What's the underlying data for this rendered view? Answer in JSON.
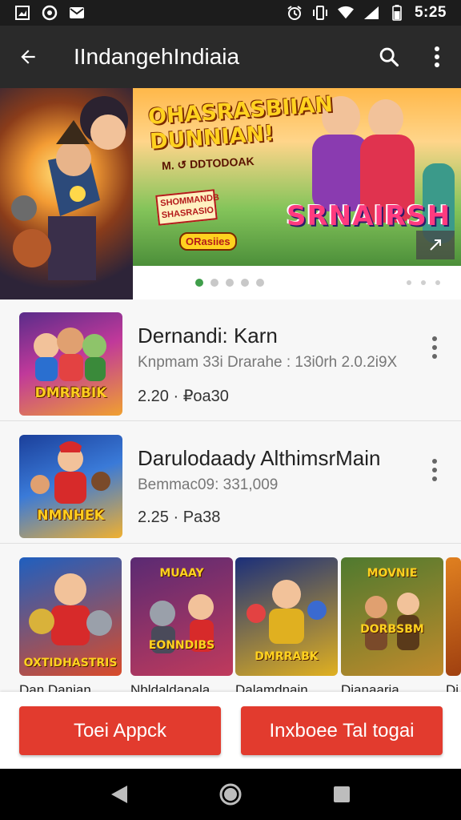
{
  "status_bar": {
    "time": "5:25",
    "icons_left": [
      "gallery-icon",
      "circle-app-icon",
      "mail-icon"
    ],
    "icons_right": [
      "alarm-icon",
      "vibrate-icon",
      "wifi-icon",
      "signal-icon",
      "battery-icon"
    ]
  },
  "app_bar": {
    "title": "IIndangehIndiaia",
    "back_icon": "arrow-back-icon",
    "search_icon": "search-icon",
    "overflow_icon": "more-vert-icon"
  },
  "banner": {
    "headline": "OHASRASBIIAN DUNNIAN!",
    "sub": "M. ↺ DDTODOAK",
    "tag": "SHOMMANDB SHASRASIO",
    "badge": "ORasiies",
    "brand": "SRNAIRSH",
    "more_icon": "expand-icon",
    "dots_main": 5,
    "dots_extra": 3,
    "active_dot": 0
  },
  "apps": [
    {
      "name": "Dernandi: Karn",
      "meta": "Knpmam 33i Drarahe : 13i0rh 2.0.2i9X",
      "price": "2.20 · ₽oa30",
      "thumb_label": "DMRRBIK"
    },
    {
      "name": "Darulodaady AlthimsrMain",
      "meta": "Bemmac09: 331,009",
      "price": "2.25 · Pa38",
      "thumb_label": "NMNHEK"
    }
  ],
  "carousel": [
    {
      "title": "Dan Danian",
      "label": "OXTIDHASTRIS",
      "colors": [
        "#1f5fbf",
        "#d94b2a"
      ]
    },
    {
      "title": "Nbldaldanala",
      "label": "EONNDIBS",
      "colors": [
        "#5a2a73",
        "#c03a5c"
      ]
    },
    {
      "title": "Dalamdnain",
      "label": "DMRRABK",
      "colors": [
        "#1b2f7a",
        "#e0b020"
      ]
    },
    {
      "title": "Dianaaria",
      "label": "DORBSBM",
      "colors": [
        "#4f7a2f",
        "#c08a2b"
      ]
    },
    {
      "title": "Di",
      "label": "",
      "colors": [
        "#e08020",
        "#a04010"
      ]
    }
  ],
  "buttons": {
    "left": "Toei Appck",
    "right": "Inxboee Tal togai"
  },
  "nav": {
    "back_icon": "nav-back-icon",
    "home_icon": "nav-home-icon",
    "recents_icon": "nav-recents-icon"
  },
  "colors": {
    "status_bar": "#1c1c1c",
    "app_bar": "#2a2a2a",
    "primary_button": "#e23b2e",
    "active_dot": "#3f9e4a"
  }
}
